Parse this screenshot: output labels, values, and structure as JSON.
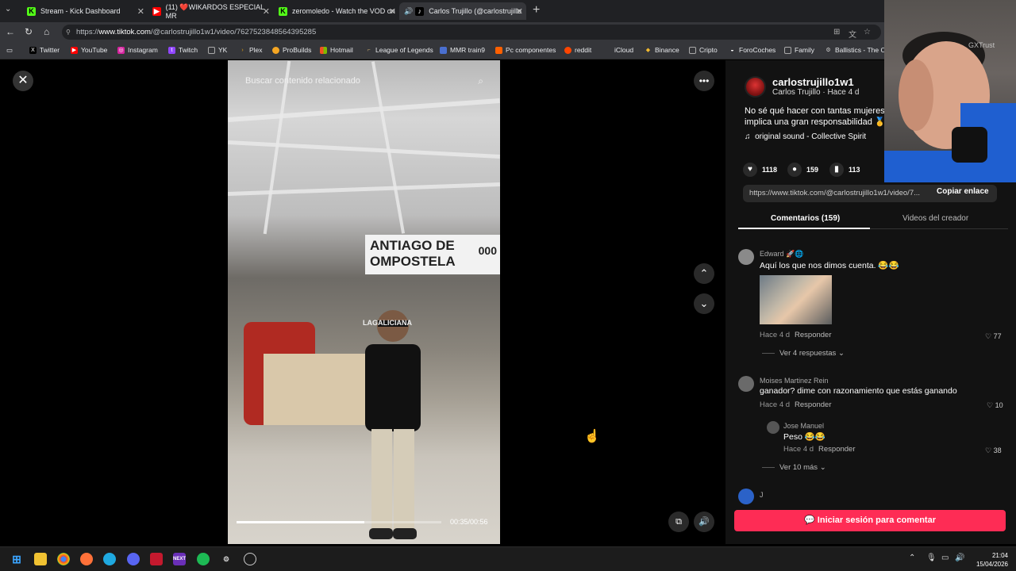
{
  "browser": {
    "tabs": [
      {
        "label": "Stream - Kick Dashboard",
        "icon": "kick-icon",
        "color": "#53fc18"
      },
      {
        "label": "(11) ❤️WIKARDOS ESPECIAL MR",
        "icon": "youtube-icon",
        "color": "#ff0000"
      },
      {
        "label": "zeromoledo - Watch the VOD on",
        "icon": "kick-icon",
        "color": "#53fc18"
      },
      {
        "label": "Carlos Trujillo (@carlostrujillo",
        "icon": "tiktok-icon",
        "color": "#ffffff"
      }
    ],
    "url_prefix": "https://",
    "url_host": "www.tiktok.com",
    "url_path": "/@carlostrujillo1w1/video/7627523848564395285",
    "bookmarks": [
      "Twitter",
      "YouTube",
      "Instagram",
      "Twitch",
      "YK",
      "Plex",
      "ProBuilds",
      "Hotmail",
      "League of Legends",
      "MMR train9",
      "Pc componentes",
      "reddit",
      "iCloud",
      "Binance",
      "Cripto",
      "ForoCoches",
      "Family",
      "Ballistics - The Of"
    ]
  },
  "video": {
    "search_placeholder": "Buscar contenido relacionado",
    "sign_text": "ANTIAGO DE OMPOSTELA",
    "sign_number": "000",
    "shirt_text": "LAGALICIANA",
    "time": "00:35/00:56",
    "progress": 0.625
  },
  "post": {
    "username": "carlostrujillo1w1",
    "subline": "Carlos Trujillo · Hace 4 d",
    "caption_line1": "No sé qué hacer con tantas mujeres",
    "caption_line2": "implica una gran responsabilidad 🥇",
    "sound": "original sound - Collective Spirit",
    "likes": "1118",
    "comments": "159",
    "saves": "113",
    "link": "https://www.tiktok.com/@carlostrujillo1w1/video/7...",
    "copy_link_label": "Copiar enlace",
    "tab_comments": "Comentarios (159)",
    "tab_creator": "Videos del creador"
  },
  "comments": [
    {
      "name": "Edward 🚀🌐",
      "text": "Aquí los que nos dimos cuenta. 😂😂",
      "meta": "Hace 4 d",
      "reply": "Responder",
      "likes": "77",
      "more": "Ver 4 respuestas"
    },
    {
      "name": "Moises Martinez Rein",
      "text": "ganador? dime con razonamiento que estás ganando",
      "meta": "Hace 4 d",
      "reply": "Responder",
      "likes": "10"
    },
    {
      "name": "Jose Manuel",
      "text": "Peso 😂😂",
      "meta": "Hace 4 d",
      "reply": "Responder",
      "likes": "38",
      "more": "Ver 10 más"
    },
    {
      "name": "J"
    }
  ],
  "login_label": "Iniciar sesión para comentar",
  "webcam_tag": "GXTrust",
  "taskbar": {
    "time": "21:04",
    "date": "15/04/2026"
  }
}
